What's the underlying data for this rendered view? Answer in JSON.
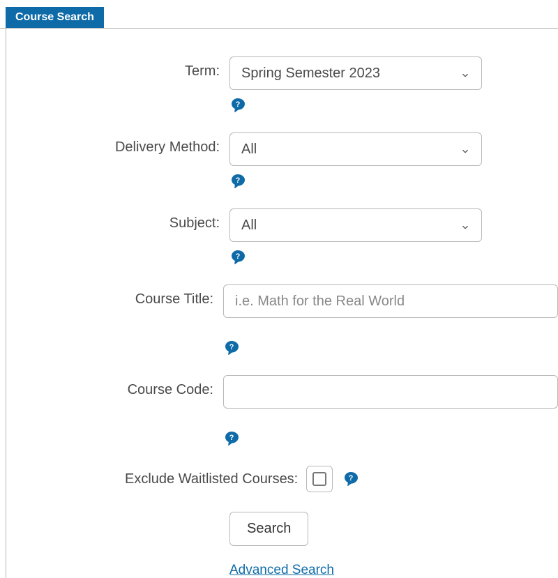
{
  "tab": {
    "label": "Course Search"
  },
  "form": {
    "term": {
      "label": "Term:",
      "value": "Spring Semester 2023"
    },
    "deliveryMethod": {
      "label": "Delivery Method:",
      "value": "All"
    },
    "subject": {
      "label": "Subject:",
      "value": "All"
    },
    "courseTitle": {
      "label": "Course Title:",
      "placeholder": "i.e. Math for the Real World",
      "value": ""
    },
    "courseCode": {
      "label": "Course Code:",
      "placeholder": "",
      "value": ""
    },
    "excludeWaitlisted": {
      "label": "Exclude Waitlisted Courses:",
      "checked": false
    }
  },
  "actions": {
    "searchLabel": "Search",
    "advancedLabel": "Advanced Search"
  },
  "helpGlyph": "?"
}
